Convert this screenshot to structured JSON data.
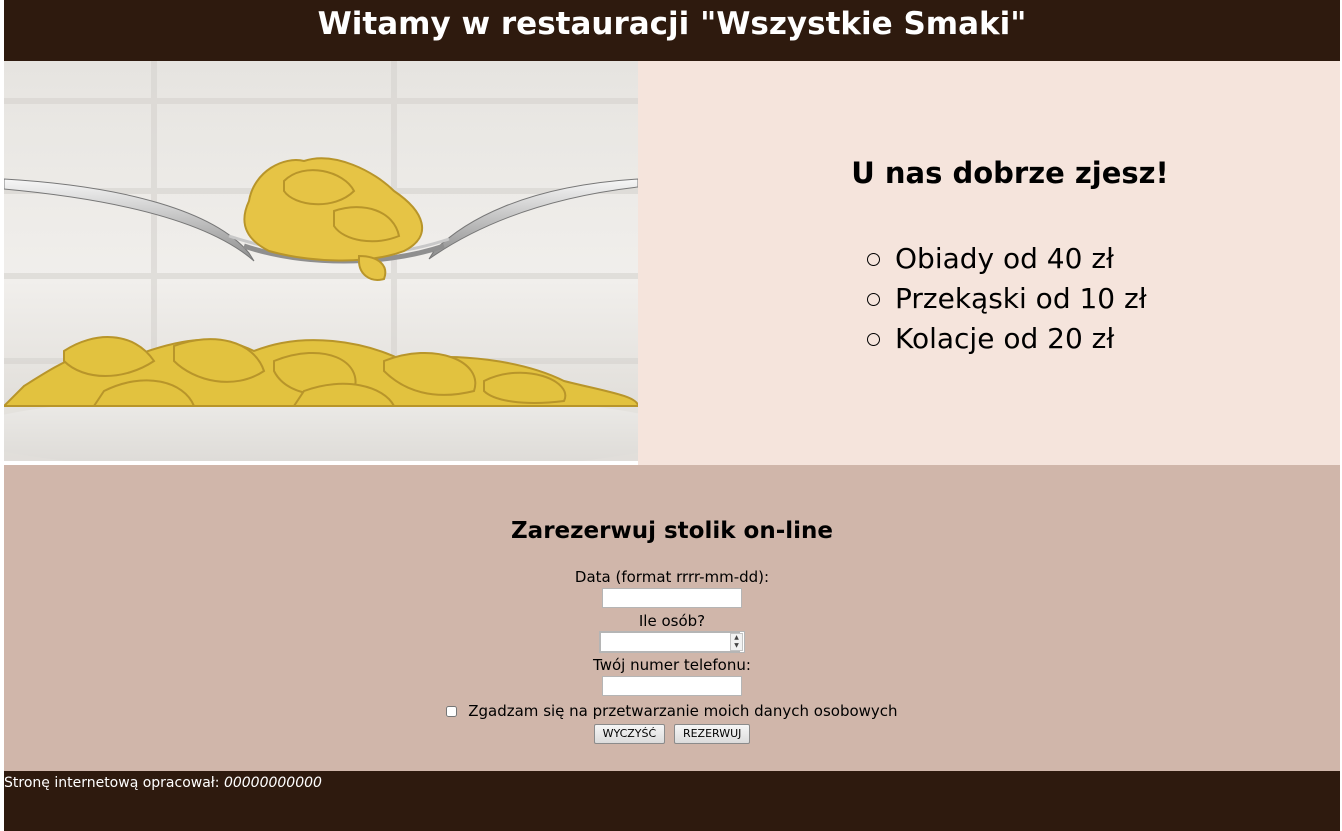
{
  "header": {
    "title": "Witamy w restauracji \"Wszystkie Smaki\""
  },
  "image": {
    "subject": "pasta-on-fork-photo"
  },
  "offer": {
    "heading": "U nas dobrze zjesz!",
    "items": [
      "Obiady od 40 zł",
      "Przekąski od 10 zł",
      "Kolacje od 20 zł"
    ]
  },
  "reservation": {
    "heading": "Zarezerwuj stolik on-line",
    "date_label": "Data (format rrrr-mm-dd):",
    "date_value": "",
    "people_label": "Ile osób?",
    "people_value": "",
    "phone_label": "Twój numer telefonu:",
    "phone_value": "",
    "consent_label": "Zgadzam się na przetwarzanie moich danych osobowych",
    "consent_checked": false,
    "clear_button": "WYCZYŚĆ",
    "submit_button": "REZERWUJ"
  },
  "footer": {
    "text": "Stronę internetową opracował: ",
    "author": "00000000000"
  },
  "colors": {
    "header_bg": "#2e1a0e",
    "offer_bg": "#f5e4dc",
    "reservation_bg": "#d0b6aa",
    "footer_bg": "#2e1a0e"
  }
}
